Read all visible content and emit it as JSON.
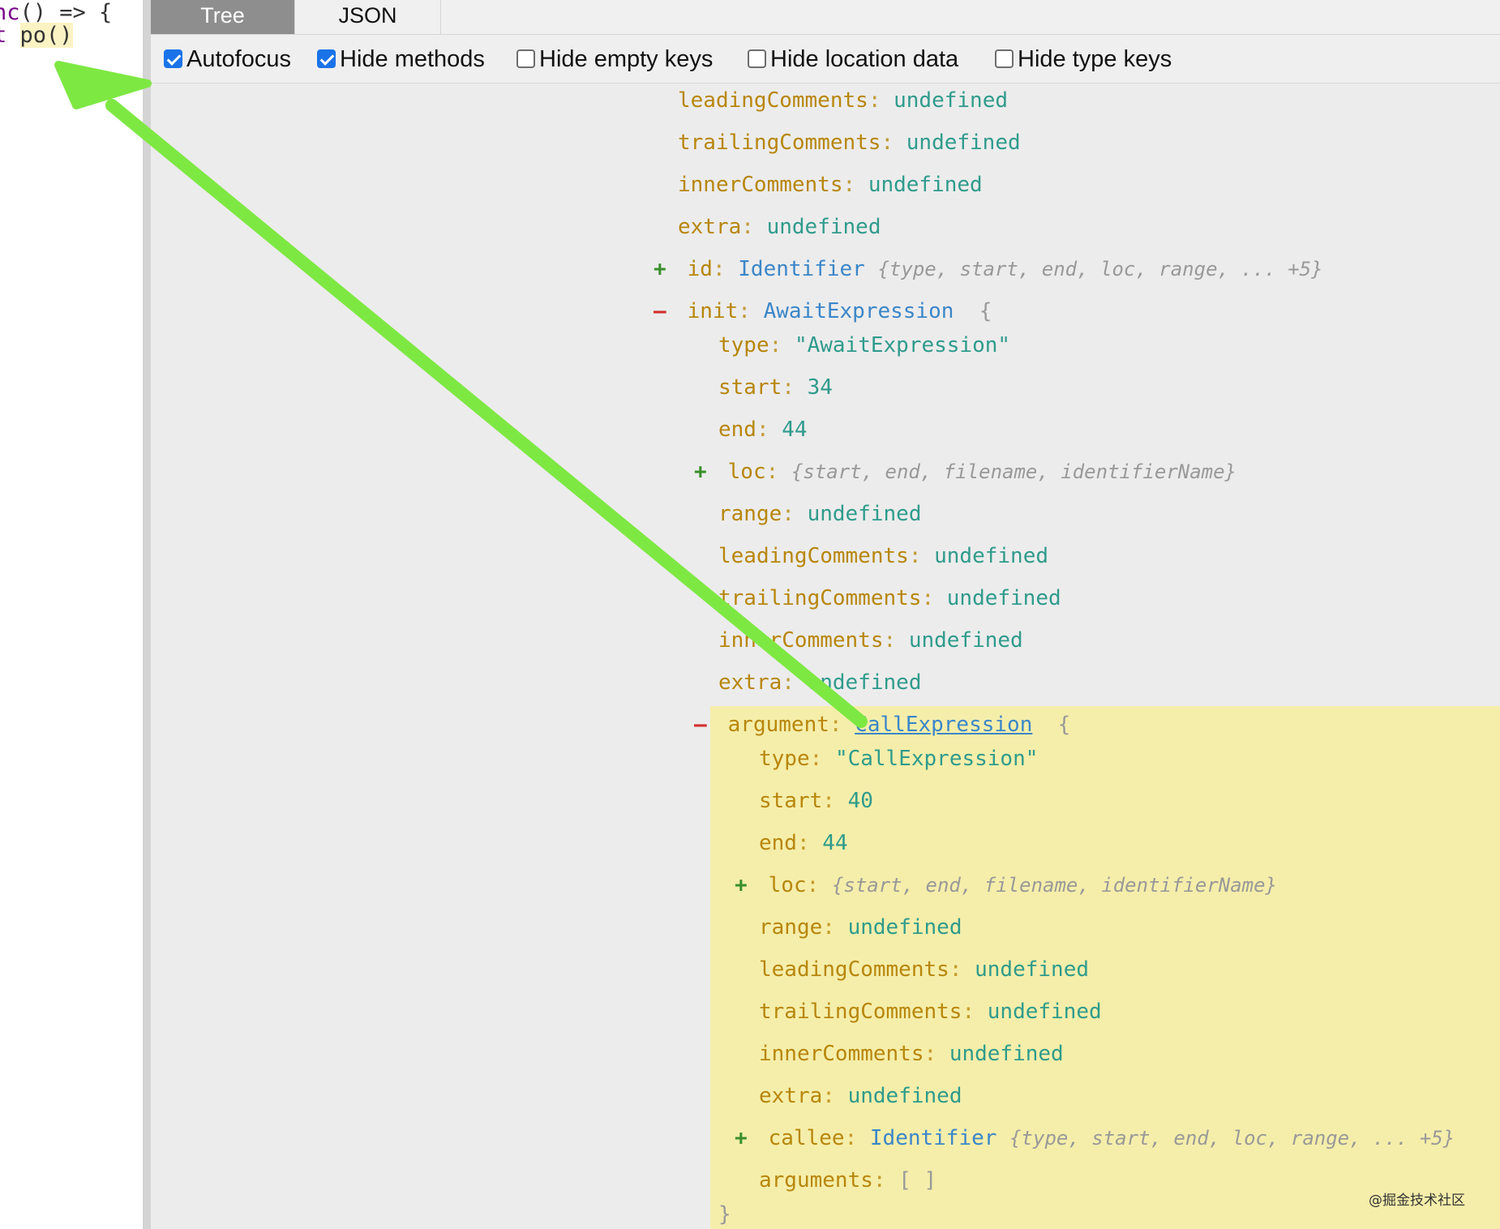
{
  "editor": {
    "line1_kw": "nc",
    "line1_rest": "() => {",
    "line2_kw": "t",
    "line2_hl": "po()"
  },
  "tabs": {
    "tree": "Tree",
    "json": "JSON"
  },
  "options": {
    "autofocus": "Autofocus",
    "hide_methods": "Hide methods",
    "hide_empty_keys": "Hide empty keys",
    "hide_location_data": "Hide location data",
    "hide_type_keys": "Hide type keys"
  },
  "tree": {
    "outer": {
      "leadingComments": {
        "key": "leadingComments",
        "value": "undefined"
      },
      "trailingComments": {
        "key": "trailingComments",
        "value": "undefined"
      },
      "innerComments": {
        "key": "innerComments",
        "value": "undefined"
      },
      "extra": {
        "key": "extra",
        "value": "undefined"
      },
      "id": {
        "key": "id",
        "type": "Identifier",
        "summary": "{type, start, end, loc, range, ... +5}"
      },
      "init": {
        "key": "init",
        "type": "AwaitExpression",
        "brace": "{"
      }
    },
    "init": {
      "type": {
        "key": "type",
        "value": "\"AwaitExpression\""
      },
      "start": {
        "key": "start",
        "value": "34"
      },
      "end": {
        "key": "end",
        "value": "44"
      },
      "loc": {
        "key": "loc",
        "summary": "{start, end, filename, identifierName}"
      },
      "range": {
        "key": "range",
        "value": "undefined"
      },
      "leadingComments": {
        "key": "leadingComments",
        "value": "undefined"
      },
      "trailingComments": {
        "key": "trailingComments",
        "value": "undefined"
      },
      "innerComments": {
        "key": "innerComments",
        "value": "undefined"
      },
      "extra": {
        "key": "extra",
        "value": "undefined"
      },
      "argument": {
        "key": "argument",
        "type": "CallExpression",
        "brace": "{"
      }
    },
    "argument": {
      "type": {
        "key": "type",
        "value": "\"CallExpression\""
      },
      "start": {
        "key": "start",
        "value": "40"
      },
      "end": {
        "key": "end",
        "value": "44"
      },
      "loc": {
        "key": "loc",
        "summary": "{start, end, filename, identifierName}"
      },
      "range": {
        "key": "range",
        "value": "undefined"
      },
      "leadingComments": {
        "key": "leadingComments",
        "value": "undefined"
      },
      "trailingComments": {
        "key": "trailingComments",
        "value": "undefined"
      },
      "innerComments": {
        "key": "innerComments",
        "value": "undefined"
      },
      "extra": {
        "key": "extra",
        "value": "undefined"
      },
      "callee": {
        "key": "callee",
        "type": "Identifier",
        "summary": "{type, start, end, loc, range, ... +5}"
      },
      "arguments": {
        "key": "arguments",
        "value": "[ ]"
      },
      "close": "}"
    },
    "symbols": {
      "plus": "+",
      "minus": "–",
      "colon": ":"
    }
  },
  "watermark": "@掘金技术社区",
  "colors": {
    "arrow": "#7ee843",
    "highlight": "#f5eeaa",
    "checkbox": "#1a73e8"
  }
}
